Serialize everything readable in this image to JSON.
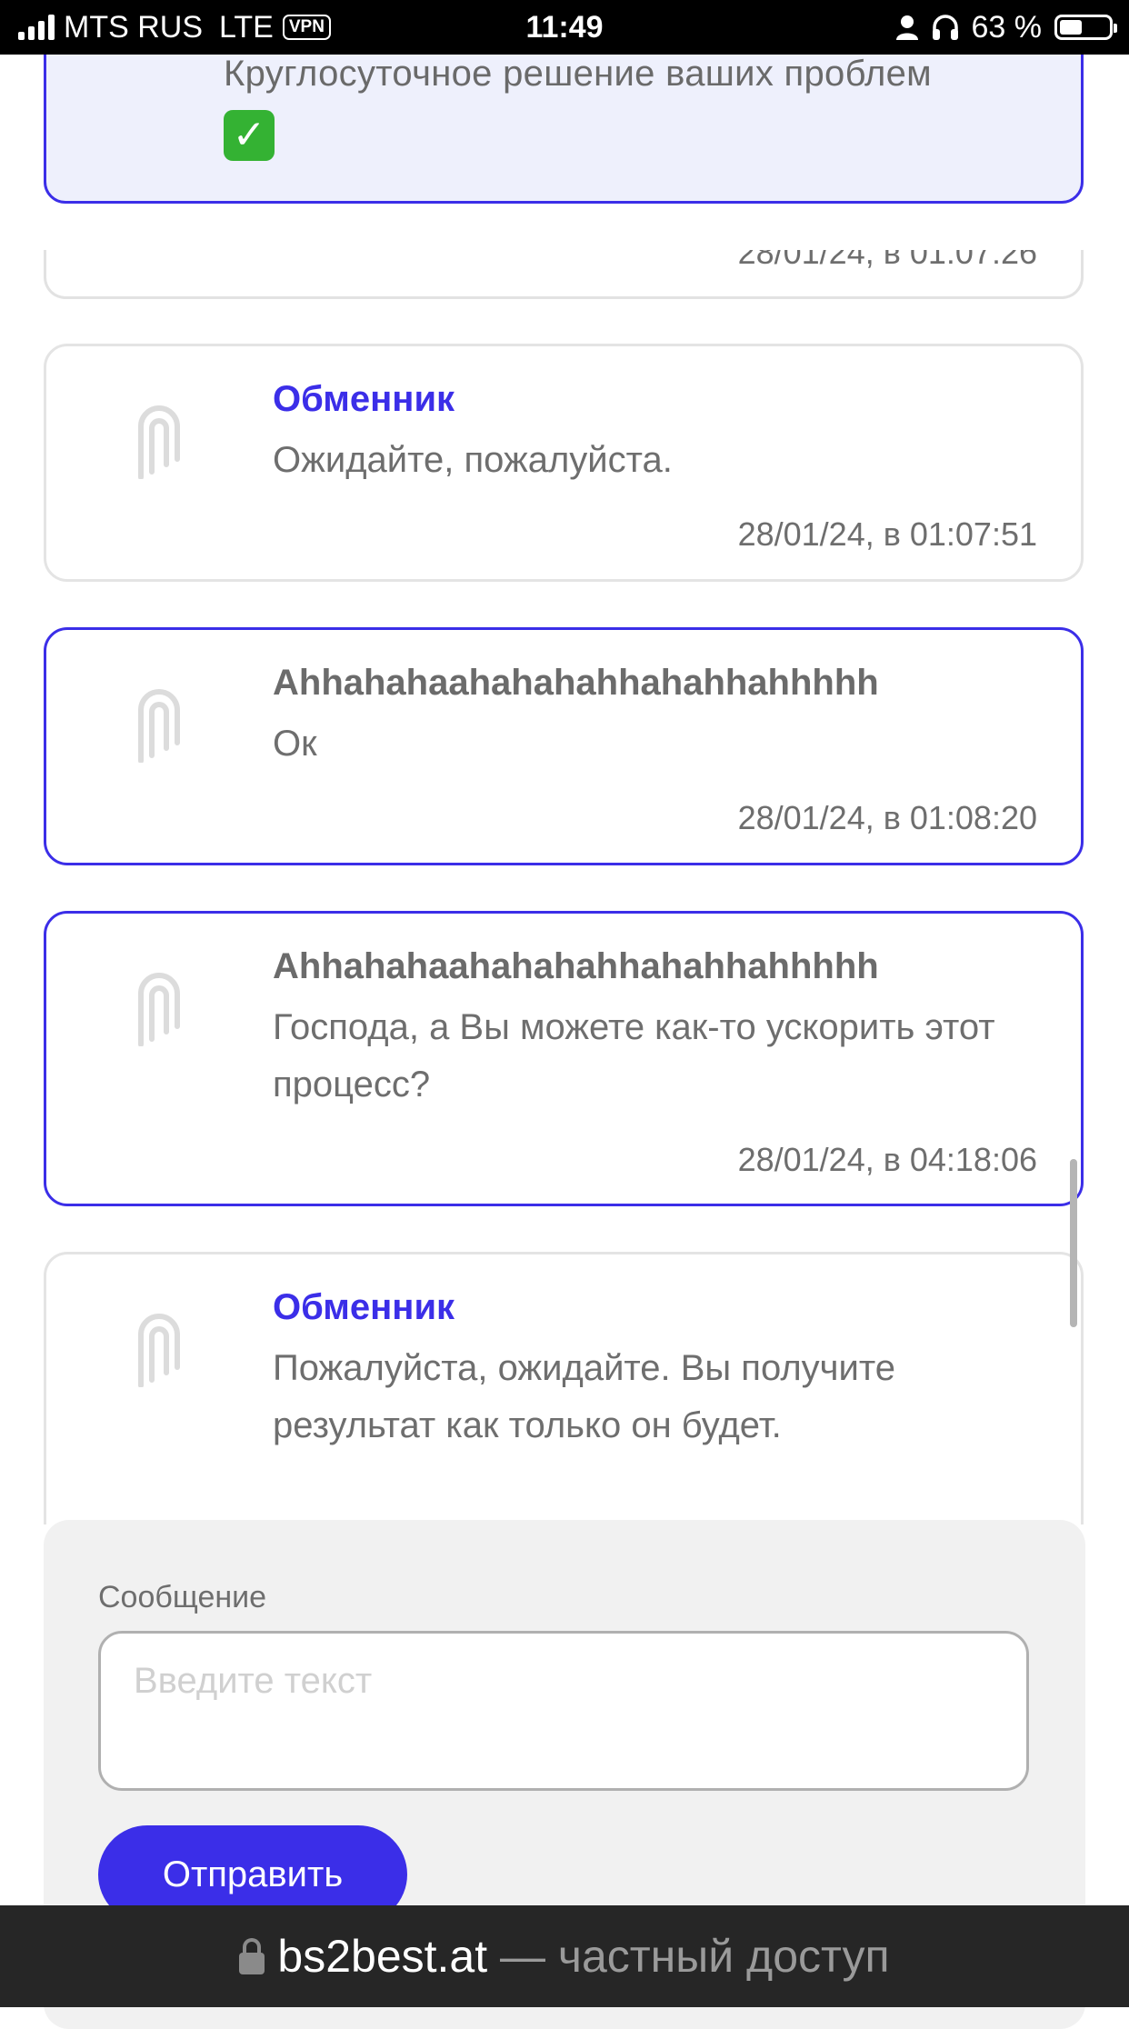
{
  "status_bar": {
    "carrier": "MTS RUS",
    "network": "LTE",
    "vpn": "VPN",
    "time": "11:49",
    "battery": "63 %"
  },
  "banner": {
    "text": "Круглосуточное решение ваших проблем",
    "emoji": "✅"
  },
  "partial_message": {
    "timestamp": "28/01/24, в 01:07:26"
  },
  "messages": [
    {
      "sender": "Обменник",
      "text": "Ожидайте, пожалуйста.",
      "timestamp": "28/01/24, в 01:07:51",
      "type": "bot"
    },
    {
      "sender": "Ahhahahaahahahahhahahhahhhhh",
      "text": "Ок",
      "timestamp": "28/01/24, в 01:08:20",
      "type": "user"
    },
    {
      "sender": "Ahhahahaahahahahhahahhahhhhh",
      "text": "Господа, а Вы можете как-то ускорить этот процесс?",
      "timestamp": "28/01/24, в 04:18:06",
      "type": "user"
    },
    {
      "sender": "Обменник",
      "text": "Пожалуйста, ожидайте. Вы получите результат как только он будет.",
      "type": "bot"
    }
  ],
  "composer": {
    "label": "Сообщение",
    "placeholder": "Введите текст",
    "value": "",
    "send_label": "Отправить"
  },
  "address_bar": {
    "domain": "bs2best.at",
    "suffix": " — частный доступ"
  },
  "colors": {
    "accent": "#3b2ee8",
    "banner_bg": "#eef0fc",
    "muted_text": "#6e6e6e"
  },
  "icons": {
    "avatar": "exchange-logo-icon",
    "lock": "lock-icon"
  }
}
